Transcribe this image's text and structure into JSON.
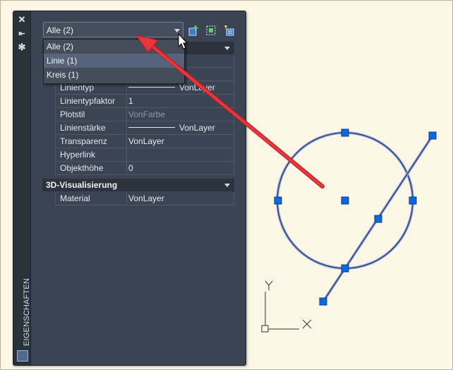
{
  "palette": {
    "vertical_title": "EIGENSCHAFTEN",
    "strip_icons": [
      "close-icon",
      "pin-icon",
      "settings-icon"
    ],
    "selection": {
      "current": "Alle (2)",
      "options": [
        "Alle (2)",
        "Linie (1)",
        "Kreis (1)"
      ]
    },
    "toolbar_icons": [
      "toggle-pickadd-icon",
      "select-objects-icon",
      "quick-select-icon"
    ],
    "properties": [
      {
        "name": "Linientyp",
        "value": "VonLayer",
        "line": true
      },
      {
        "name": "Linientypfaktor",
        "value": "1"
      },
      {
        "name": "Plotstil",
        "value": "VonFarbe",
        "muted": true
      },
      {
        "name": "Linienstärke",
        "value": "VonLayer",
        "line": true
      },
      {
        "name": "Transparenz",
        "value": "VonLayer"
      },
      {
        "name": "Hyperlink",
        "value": ""
      },
      {
        "name": "Objekthöhe",
        "value": "0"
      }
    ],
    "category_3d": "3D-Visualisierung",
    "properties_3d": [
      {
        "name": "Material",
        "value": "VonLayer"
      }
    ]
  },
  "drawing": {
    "ucs_x_label": "X",
    "ucs_y_label": "Y"
  },
  "colors": {
    "palette_bg": "#3b4453",
    "grip": "#0a6be0",
    "geometry": "#24428f",
    "arrow": "#e8363c",
    "canvas": "#fbf6e6"
  }
}
